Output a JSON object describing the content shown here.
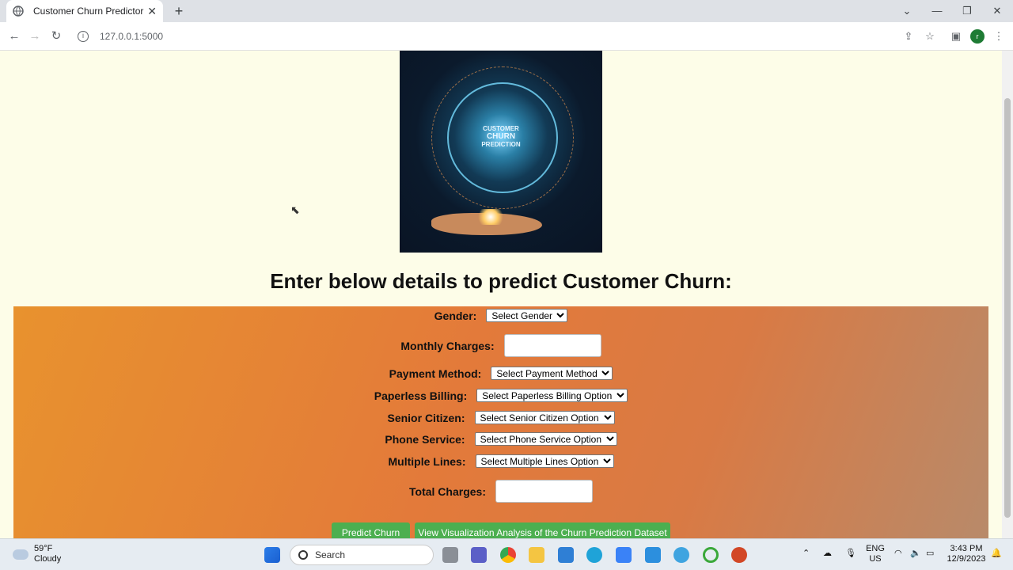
{
  "browser": {
    "tab_title": "Customer Churn Predictor",
    "tab_close": "✕",
    "new_tab": "+",
    "url": "127.0.0.1:5000",
    "profile_initial": "r"
  },
  "hero": {
    "line1": "CUSTOMER",
    "line2": "CHURN",
    "line3": "PREDICTION"
  },
  "page": {
    "heading": "Enter below details to predict Customer Churn:"
  },
  "form": {
    "gender": {
      "label": "Gender:",
      "selected": "Select Gender"
    },
    "monthly_charges": {
      "label": "Monthly Charges:",
      "value": ""
    },
    "payment_method": {
      "label": "Payment Method:",
      "selected": "Select Payment Method"
    },
    "paperless_billing": {
      "label": "Paperless Billing:",
      "selected": "Select Paperless Billing Option"
    },
    "senior_citizen": {
      "label": "Senior Citizen:",
      "selected": "Select Senior Citizen Option"
    },
    "phone_service": {
      "label": "Phone Service:",
      "selected": "Select Phone Service Option"
    },
    "multiple_lines": {
      "label": "Multiple Lines:",
      "selected": "Select Multiple Lines Option"
    },
    "total_charges": {
      "label": "Total Charges:",
      "value": ""
    }
  },
  "buttons": {
    "predict": "Predict Churn",
    "visualize": "View Visualization Analysis of the Churn Prediction Dataset"
  },
  "taskbar": {
    "weather_temp": "59°F",
    "weather_desc": "Cloudy",
    "search_label": "Search",
    "lang_line1": "ENG",
    "lang_line2": "US",
    "time": "3:43 PM",
    "date": "12/9/2023"
  },
  "colors": {
    "page_bg": "#fdfde8",
    "button_green": "#4caf50",
    "panel_orange": "#e37a3a"
  }
}
